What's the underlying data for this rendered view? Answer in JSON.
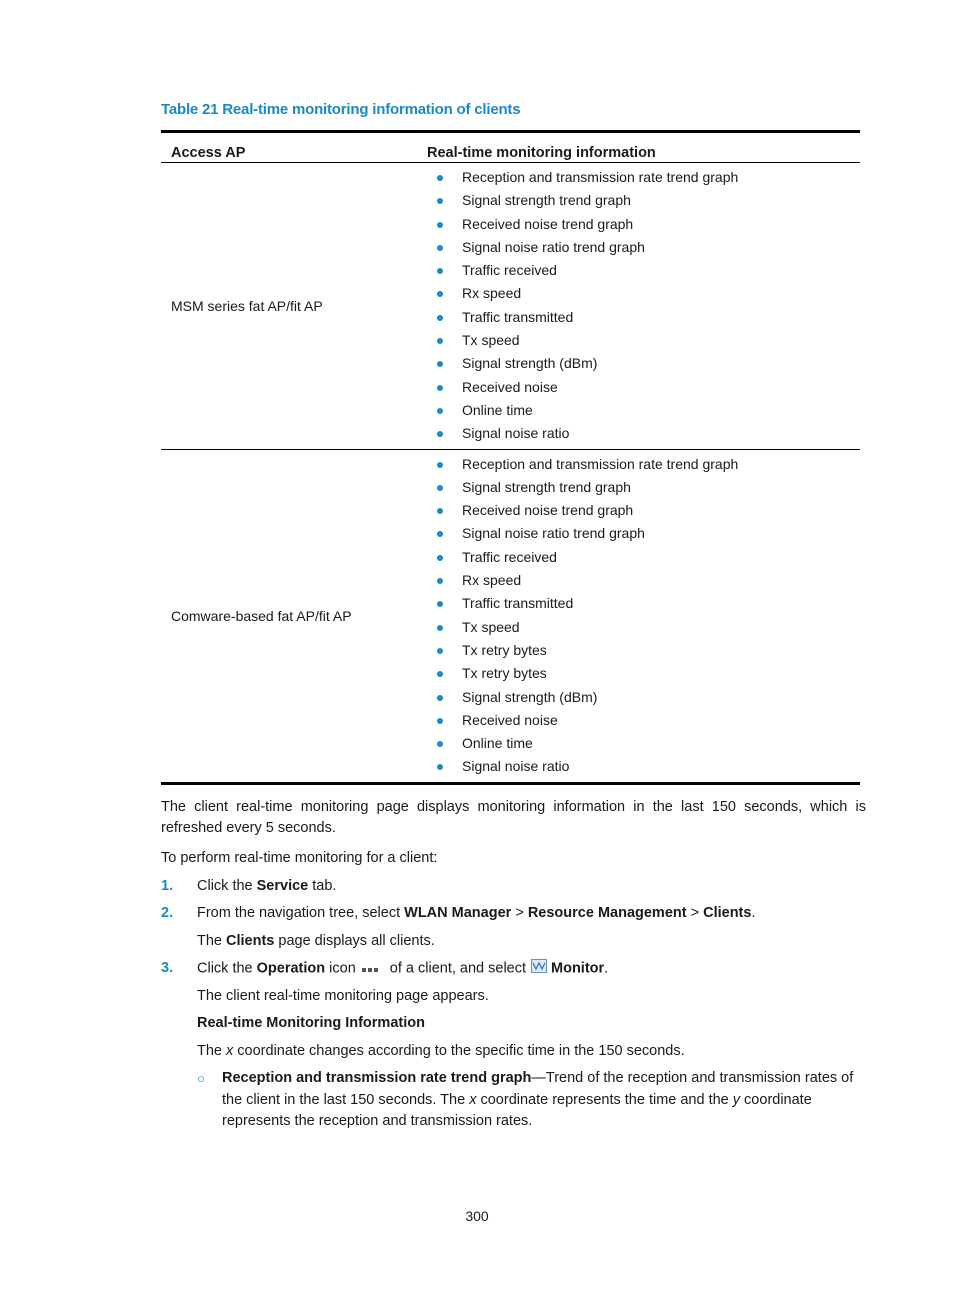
{
  "table": {
    "caption": "Table 21 Real-time monitoring information of clients",
    "headers": [
      "Access AP",
      "Real-time monitoring information"
    ],
    "rows": [
      {
        "access_ap": "MSM series fat AP/fit AP",
        "items": [
          "Reception and transmission rate trend graph",
          "Signal strength trend graph",
          "Received noise trend graph",
          "Signal noise ratio trend graph",
          "Traffic received",
          "Rx speed",
          "Traffic transmitted",
          "Tx speed",
          "Signal strength (dBm)",
          "Received noise",
          "Online time",
          "Signal noise ratio"
        ]
      },
      {
        "access_ap": "Comware-based fat AP/fit AP",
        "items": [
          "Reception and transmission rate trend graph",
          "Signal strength trend graph",
          "Received noise trend graph",
          "Signal noise ratio trend graph",
          "Traffic received",
          "Rx speed",
          "Traffic transmitted",
          "Tx speed",
          "Tx retry bytes",
          "Tx retry bytes",
          "Signal strength (dBm)",
          "Received noise",
          "Online time",
          "Signal noise ratio"
        ]
      }
    ]
  },
  "body": {
    "intro": "The client real-time monitoring page displays monitoring information in the last 150 seconds, which is refreshed every 5 seconds.",
    "procedure_intro": "To perform real-time monitoring for a client:",
    "steps": [
      {
        "num": "1.",
        "pre": "Click the ",
        "b1": "Service",
        "post": " tab."
      },
      {
        "num": "2.",
        "pre": "From the navigation tree, select ",
        "b1": "WLAN Manager",
        "sep1": " > ",
        "b2": "Resource Management",
        "sep2": " > ",
        "b3": "Clients",
        "post": "."
      },
      {
        "num": "3.",
        "pre": "Click the ",
        "b1": "Operation",
        "mid": " icon",
        "mid2": " of a client, and select",
        "b2": "Monitor",
        "post": "."
      }
    ],
    "step2_result": {
      "pre": "The ",
      "b": "Clients",
      "post": " page displays all clients."
    },
    "step3_result": "The client real-time monitoring page appears.",
    "subheading": "Real-time Monitoring Information",
    "x_note": {
      "pre": "The ",
      "i": "x",
      "post": " coordinate changes according to the specific time in the 150 seconds."
    },
    "sub_bullet": {
      "marker": "○",
      "b": "Reception and transmission rate trend graph",
      "t1": "—Trend of the reception and transmission rates of the client in the last 150 seconds. The ",
      "i1": "x",
      "t2": " coordinate represents the time and the ",
      "i2": "y",
      "t3": " coordinate represents the reception and transmission rates."
    }
  },
  "icons": {
    "operation": "more-dots-icon",
    "monitor": "monitor-wave-icon"
  },
  "colors": {
    "accent": "#1a8ac6",
    "text": "#1a1a1a"
  },
  "page_number": "300"
}
